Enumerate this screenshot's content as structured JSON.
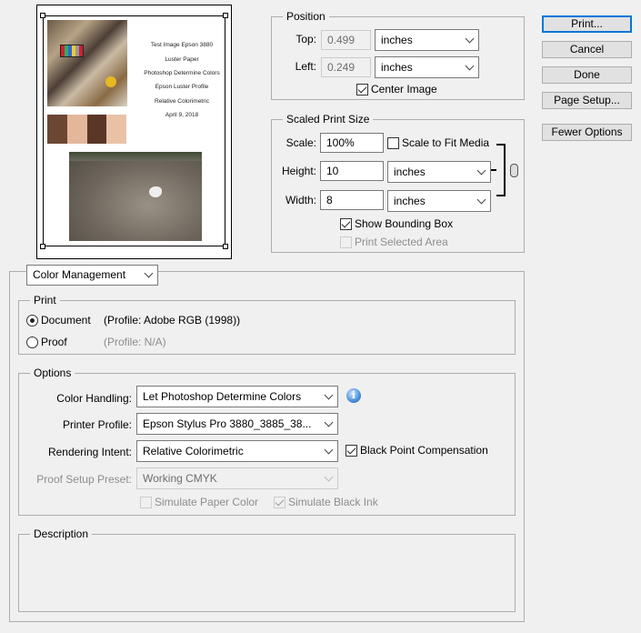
{
  "preview": {
    "text_lines": [
      "Test Image Epson 3880",
      "Luster Paper",
      "Photoshop Determine Colors",
      "Epson Luster Profile",
      "Relative Colorimetric",
      "April 9, 2018"
    ]
  },
  "position": {
    "legend": "Position",
    "top_label": "Top:",
    "top_value": "0.499",
    "top_unit": "inches",
    "left_label": "Left:",
    "left_value": "0.249",
    "left_unit": "inches",
    "center_image_label": "Center Image",
    "center_image_checked": true
  },
  "scaled": {
    "legend": "Scaled Print Size",
    "scale_label": "Scale:",
    "scale_value": "100%",
    "scale_to_fit_label": "Scale to Fit Media",
    "scale_to_fit_checked": false,
    "height_label": "Height:",
    "height_value": "10",
    "height_unit": "inches",
    "width_label": "Width:",
    "width_value": "8",
    "width_unit": "inches",
    "show_bbox_label": "Show Bounding Box",
    "show_bbox_checked": true,
    "print_selected_label": "Print Selected Area",
    "print_selected_checked": false,
    "link_icon": "chain-link-icon"
  },
  "buttons": {
    "print": "Print...",
    "cancel": "Cancel",
    "done": "Done",
    "page_setup": "Page Setup...",
    "fewer_options": "Fewer Options"
  },
  "section_select": "Color Management",
  "print_group": {
    "legend": "Print",
    "document_label": "Document",
    "document_profile": "(Profile: Adobe RGB (1998))",
    "proof_label": "Proof",
    "proof_profile": "(Profile: N/A)",
    "selected": "Document"
  },
  "options": {
    "legend": "Options",
    "color_handling_label": "Color Handling:",
    "color_handling_value": "Let Photoshop Determine Colors",
    "printer_profile_label": "Printer Profile:",
    "printer_profile_value": "Epson Stylus Pro 3880_3885_38...",
    "rendering_intent_label": "Rendering Intent:",
    "rendering_intent_value": "Relative Colorimetric",
    "black_point_label": "Black Point Compensation",
    "black_point_checked": true,
    "proof_setup_label": "Proof Setup Preset:",
    "proof_setup_value": "Working CMYK",
    "simulate_paper_label": "Simulate Paper Color",
    "simulate_ink_label": "Simulate Black Ink",
    "info_icon": "i"
  },
  "description": {
    "legend": "Description",
    "text": ""
  }
}
